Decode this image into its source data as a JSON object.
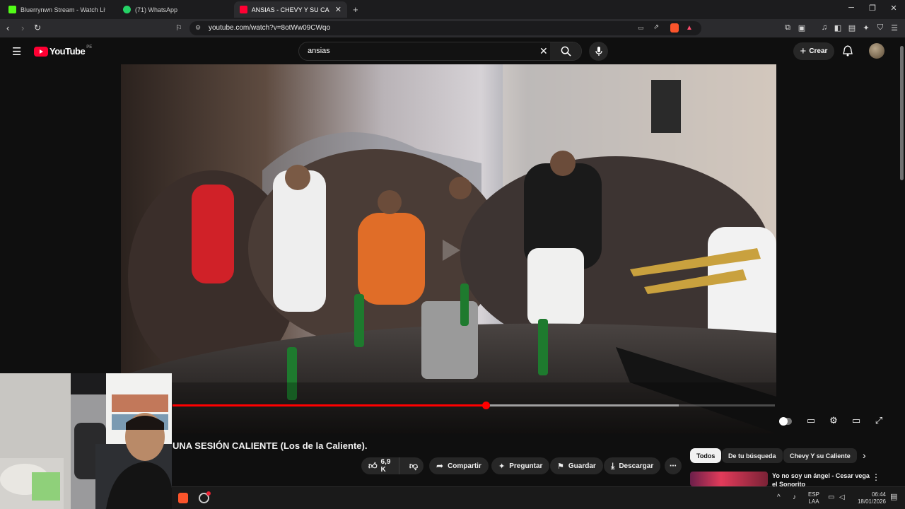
{
  "browser": {
    "tabs": [
      {
        "title": "Bluerrynwn Stream - Watch Live",
        "icon": "kick-icon",
        "color": "#53fc18"
      },
      {
        "title": "(71) WhatsApp",
        "icon": "whatsapp-icon",
        "color": "#25d366"
      },
      {
        "title": "ANSIAS - CHEVY Y SU CALIENTE",
        "icon": "youtube-icon",
        "color": "#ff0033",
        "active": true
      }
    ],
    "url": "youtube.com/watch?v=8otWw09CWqo"
  },
  "youtube": {
    "logo_text": "YouTube",
    "logo_region": "PE",
    "search_value": "ansias",
    "create_label": "Crear"
  },
  "video": {
    "title_partial": "UNA SESIÓN CALIENTE (Los de la Caliente).",
    "progress_fraction": 0.52,
    "buffered_fraction": 0.84
  },
  "actions": {
    "likes": "6,9 K",
    "share": "Compartir",
    "ask": "Preguntar",
    "save": "Guardar",
    "download": "Descargar"
  },
  "chips": [
    "Todos",
    "De tu búsqueda",
    "Chevy Y su Caliente"
  ],
  "recommendation": {
    "title": "Yo no soy un ángel - Cesar vega el Sonorito"
  },
  "taskbar": {
    "language_line1": "ESP",
    "language_line2": "LAA",
    "time": "06:44",
    "date": "18/01/2026"
  }
}
